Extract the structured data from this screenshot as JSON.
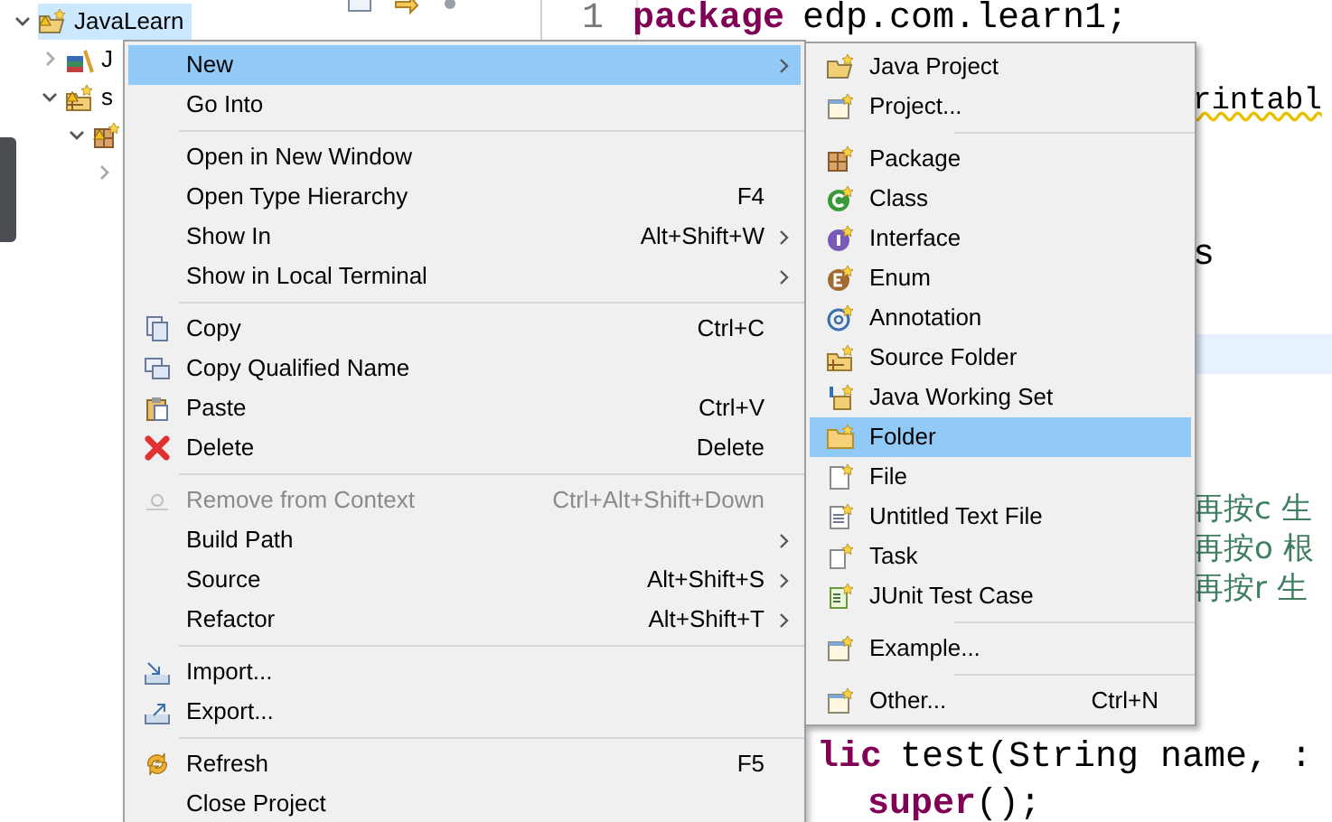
{
  "explorer": {
    "tree": [
      {
        "label": "JavaLearn",
        "selected": true,
        "expanded": true,
        "children": [
          {
            "label": "J",
            "selected": false,
            "expanded": false
          },
          {
            "label": "s",
            "selected": false,
            "expanded": true,
            "children": [
              {
                "selected": false,
                "expanded": true,
                "children": [
                  {
                    "expanded": false
                  }
                ]
              }
            ]
          }
        ]
      }
    ]
  },
  "editor": {
    "lines": [
      {
        "line_number": "1",
        "keyword": "package",
        "text": "edp.com.learn1;"
      },
      {
        "text": "rintabl",
        "warning": true
      },
      {
        "text": "s"
      },
      {
        "current": true
      },
      {
        "text": "再按c 生",
        "comment": true
      },
      {
        "text": "再按o 根",
        "comment": true
      },
      {
        "text": "再按r 生",
        "comment": true
      },
      {
        "keyword": "lic",
        "text": "test(String name, :",
        "params": true
      },
      {
        "keyword": "super",
        "text": "();"
      }
    ]
  },
  "context_menu": {
    "items": [
      {
        "kind": "item",
        "label": "New",
        "submenu": true,
        "selected": true,
        "disabled": false
      },
      {
        "kind": "item",
        "label": "Go Into",
        "selected": false,
        "disabled": false
      },
      {
        "kind": "separator"
      },
      {
        "kind": "item",
        "label": "Open in New Window",
        "selected": false,
        "disabled": false
      },
      {
        "kind": "item",
        "label": "Open Type Hierarchy",
        "shortcut": "F4",
        "selected": false,
        "disabled": false
      },
      {
        "kind": "item",
        "label": "Show In",
        "shortcut": "Alt+Shift+W",
        "submenu": true,
        "selected": false,
        "disabled": false
      },
      {
        "kind": "item",
        "label": "Show in Local Terminal",
        "submenu": true,
        "selected": false,
        "disabled": false
      },
      {
        "kind": "separator"
      },
      {
        "kind": "item",
        "label": "Copy",
        "shortcut": "Ctrl+C",
        "selected": false,
        "disabled": false
      },
      {
        "kind": "item",
        "label": "Copy Qualified Name",
        "selected": false,
        "disabled": false
      },
      {
        "kind": "item",
        "label": "Paste",
        "shortcut": "Ctrl+V",
        "selected": false,
        "disabled": false
      },
      {
        "kind": "item",
        "label": "Delete",
        "shortcut": "Delete",
        "selected": false,
        "disabled": false
      },
      {
        "kind": "separator"
      },
      {
        "kind": "item",
        "label": "Remove from Context",
        "shortcut": "Ctrl+Alt+Shift+Down",
        "selected": false,
        "disabled": true
      },
      {
        "kind": "item",
        "label": "Build Path",
        "submenu": true,
        "selected": false,
        "disabled": false
      },
      {
        "kind": "item",
        "label": "Source",
        "shortcut": "Alt+Shift+S",
        "submenu": true,
        "selected": false,
        "disabled": false
      },
      {
        "kind": "item",
        "label": "Refactor",
        "shortcut": "Alt+Shift+T",
        "submenu": true,
        "selected": false,
        "disabled": false
      },
      {
        "kind": "separator"
      },
      {
        "kind": "item",
        "label": "Import...",
        "selected": false,
        "disabled": false
      },
      {
        "kind": "item",
        "label": "Export...",
        "selected": false,
        "disabled": false
      },
      {
        "kind": "separator"
      },
      {
        "kind": "item",
        "label": "Refresh",
        "shortcut": "F5",
        "selected": false,
        "disabled": false
      },
      {
        "kind": "item",
        "label": "Close Project",
        "selected": false,
        "disabled": false
      }
    ]
  },
  "new_submenu": {
    "items": [
      {
        "kind": "item",
        "label": "Java Project",
        "selected": false
      },
      {
        "kind": "item",
        "label": "Project...",
        "selected": false
      },
      {
        "kind": "separator"
      },
      {
        "kind": "item",
        "label": "Package",
        "selected": false
      },
      {
        "kind": "item",
        "label": "Class",
        "selected": false
      },
      {
        "kind": "item",
        "label": "Interface",
        "selected": false
      },
      {
        "kind": "item",
        "label": "Enum",
        "selected": false
      },
      {
        "kind": "item",
        "label": "Annotation",
        "selected": false
      },
      {
        "kind": "item",
        "label": "Source Folder",
        "selected": false
      },
      {
        "kind": "item",
        "label": "Java Working Set",
        "selected": false
      },
      {
        "kind": "item",
        "label": "Folder",
        "selected": true
      },
      {
        "kind": "item",
        "label": "File",
        "selected": false
      },
      {
        "kind": "item",
        "label": "Untitled Text File",
        "selected": false
      },
      {
        "kind": "item",
        "label": "Task",
        "selected": false
      },
      {
        "kind": "item",
        "label": "JUnit Test Case",
        "selected": false
      },
      {
        "kind": "separator"
      },
      {
        "kind": "item",
        "label": "Example...",
        "selected": false
      },
      {
        "kind": "separator"
      },
      {
        "kind": "item",
        "label": "Other...",
        "shortcut": "Ctrl+N",
        "selected": false
      }
    ]
  }
}
